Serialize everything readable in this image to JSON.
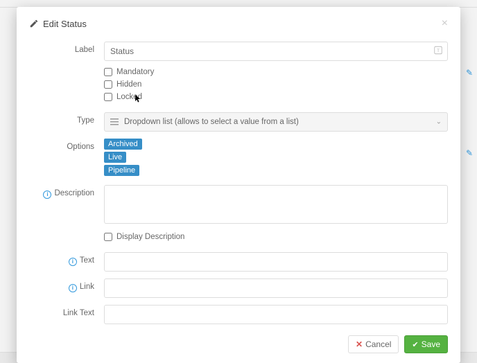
{
  "modal": {
    "title": "Edit Status",
    "close": "×"
  },
  "labels": {
    "label": "Label",
    "type": "Type",
    "options": "Options",
    "description": "Description",
    "text": "Text",
    "link": "Link",
    "link_text": "Link Text"
  },
  "fields": {
    "label_value": "Status",
    "type_value": "Dropdown list (allows to select a value from a list)",
    "description_value": "",
    "text_value": "",
    "link_value": "",
    "link_text_value": ""
  },
  "checkboxes": {
    "mandatory": "Mandatory",
    "hidden": "Hidden",
    "locked": "Locked",
    "display_description": "Display Description"
  },
  "options": [
    "Archived",
    "Live",
    "Pipeline"
  ],
  "buttons": {
    "cancel": "Cancel",
    "save": "Save"
  }
}
